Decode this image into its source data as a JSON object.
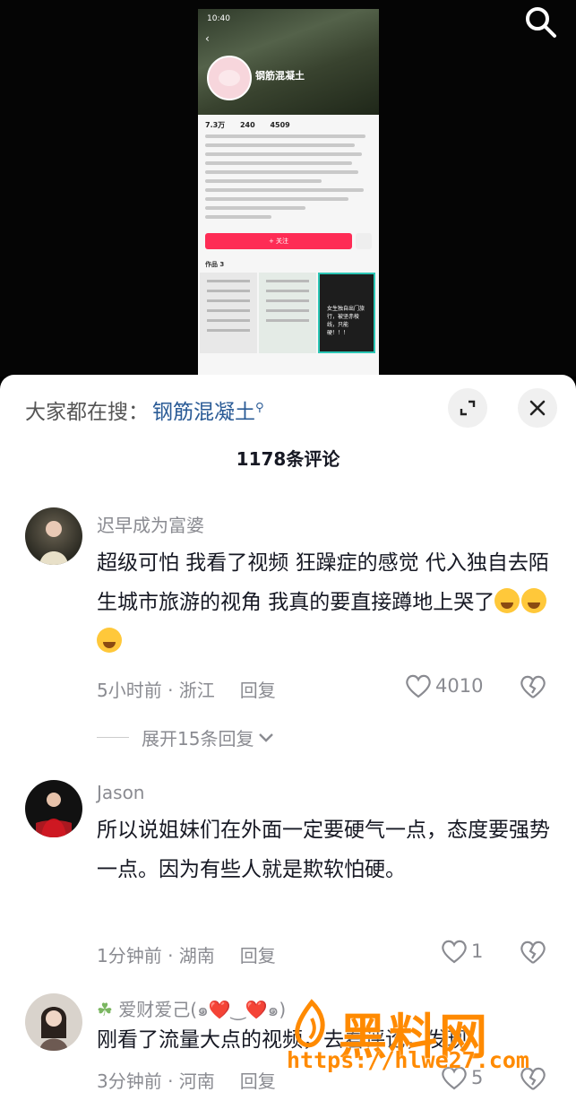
{
  "video": {
    "status_time": "10:40",
    "profile_name": "钢筋混凝土",
    "stats": [
      "7.3万",
      "240",
      "4509"
    ],
    "follow_label": "+ 关注",
    "works_label": "作品 3",
    "thumb3_text": "女生独自出门旅行，被坚赤棱线，只能硬！！！"
  },
  "header": {
    "hot_search_prefix": "大家都在搜：",
    "hot_search_keyword": "钢筋混凝土",
    "comment_count": "1178条评论"
  },
  "comments": [
    {
      "username": "迟早成为富婆",
      "text": "超级可怕 我看了视频 狂躁症的感觉 代入独自去陌生城市旅游的视角 我真的要直接蹲地上哭了",
      "time_location": "5小时前 · 浙江",
      "reply_label": "回复",
      "likes": "4010",
      "expand_label": "展开15条回复"
    },
    {
      "username": "Jason",
      "text": "所以说姐妹们在外面一定要硬气一点，态度要强势一点。因为有些人就是欺软怕硬。",
      "time_location": "1分钟前 · 湖南",
      "reply_label": "回复",
      "likes": "1"
    },
    {
      "username": "爱财爱己(๑❤️‿❤️๑)",
      "text": "刚看了流量大点的视频，去看评论，发现",
      "time_location": "3分钟前 · 河南",
      "reply_label": "回复",
      "likes": "5"
    }
  ],
  "watermark": {
    "brand": "黑料网",
    "url": "https://hlwe27.com"
  },
  "colors": {
    "accent": "#fe2c55",
    "keyword": "#2a5b96",
    "watermark": "#ff8a00"
  }
}
